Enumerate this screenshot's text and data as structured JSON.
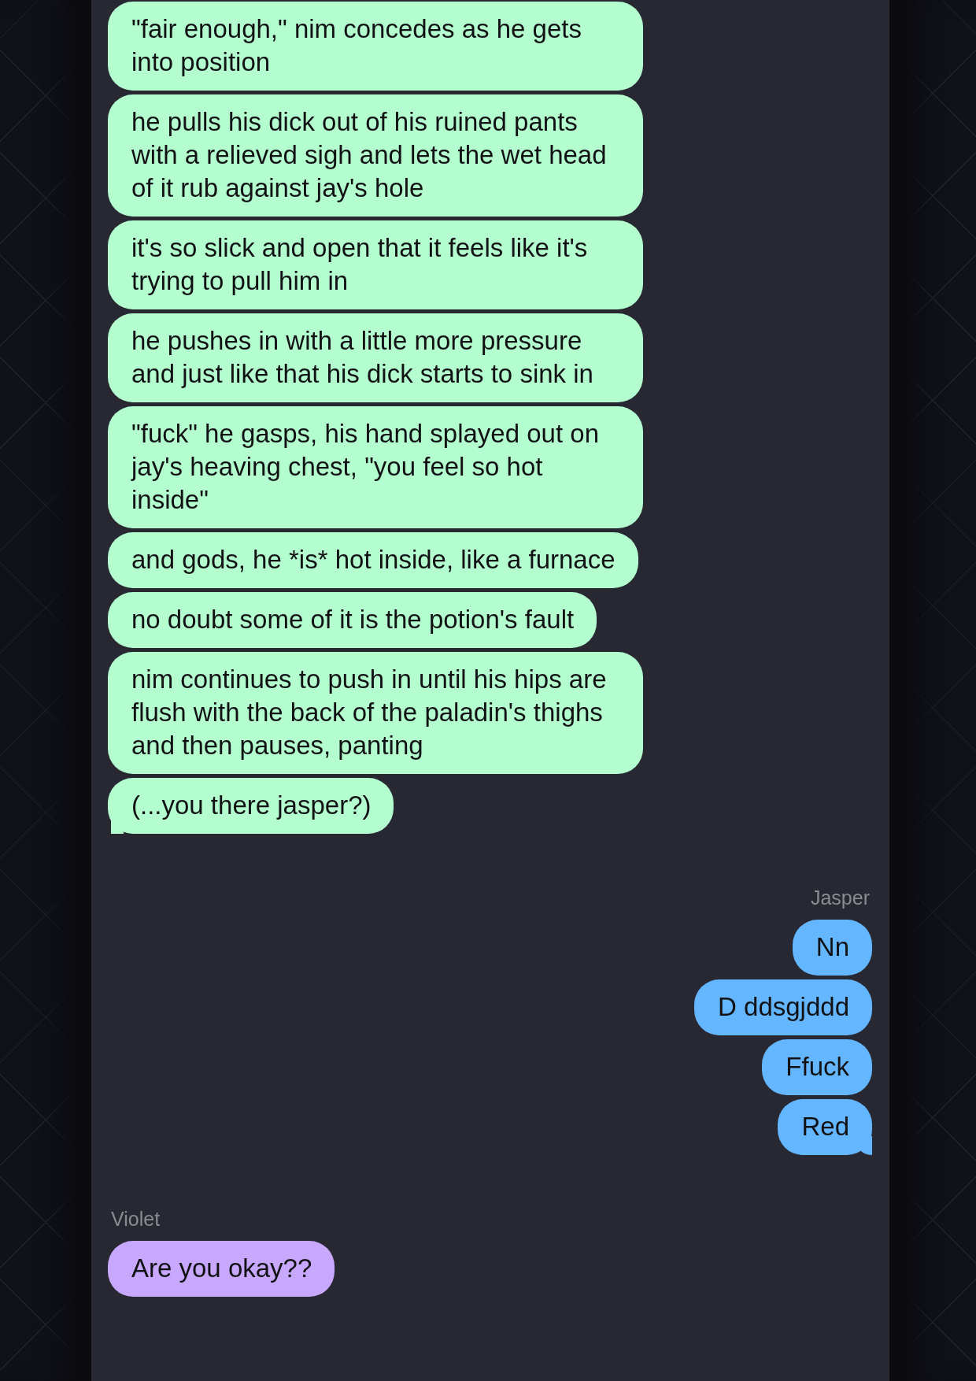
{
  "groups": [
    {
      "kind": "received",
      "color": "#b3fdcf",
      "messages": [
        {
          "text": "\"fair enough,\" nim concedes as he gets into position",
          "tail": false
        },
        {
          "text": "he pulls his dick out of his ruined pants with a relieved sigh and lets the wet head of it rub against jay's hole",
          "tail": false
        },
        {
          "text": "it's so slick and open that it feels like it's trying to pull him in",
          "tail": false
        },
        {
          "text": "he pushes in with a little more pressure and just like that his dick starts to sink in",
          "tail": false
        },
        {
          "text": "\"fuck\" he gasps, his hand splayed out on jay's heaving chest, \"you feel so hot inside\"",
          "tail": false
        },
        {
          "text": "and gods, he *is* hot inside, like a furnace",
          "tail": false
        },
        {
          "text": "no doubt some of it is the potion's fault",
          "tail": false
        },
        {
          "text": "nim continues to push in until his hips are flush with the back of the paladin's thighs and then pauses, panting",
          "tail": false
        },
        {
          "text": "(...you there jasper?)",
          "tail": true
        }
      ]
    },
    {
      "kind": "sent",
      "sender": "Jasper",
      "color": "#64b6ff",
      "messages": [
        {
          "text": "Nn",
          "tail": false
        },
        {
          "text": "D ddsgjddd",
          "tail": false
        },
        {
          "text": "Ffuck",
          "tail": false
        },
        {
          "text": "Red",
          "tail": true
        }
      ]
    },
    {
      "kind": "received",
      "sender": "Violet",
      "color": "#c8a8fd",
      "messages": [
        {
          "text": "Are you okay??",
          "tail": false
        }
      ]
    }
  ]
}
